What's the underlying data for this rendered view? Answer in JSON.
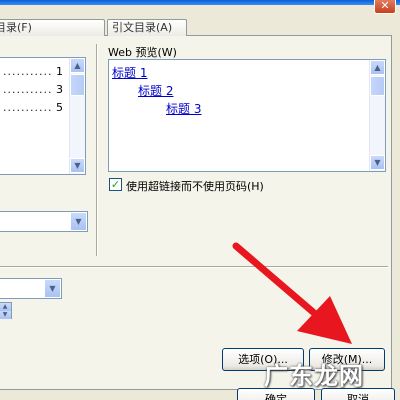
{
  "window": {
    "close_glyph": "✕"
  },
  "tabs": [
    {
      "label": "目录(F)"
    },
    {
      "label": "引文目录(A)"
    }
  ],
  "print_preview": {
    "lines": [
      {
        "dots": "...................",
        "page": "1"
      },
      {
        "dots": "...................",
        "page": "3"
      },
      {
        "dots": "...................",
        "page": "5"
      }
    ]
  },
  "web_preview": {
    "label": "Web 预览(W)",
    "headings": [
      {
        "text": "标题 1"
      },
      {
        "text": "标题 2"
      },
      {
        "text": "标题 3"
      }
    ]
  },
  "options": {
    "use_hyperlinks_label": "使用超链接而不使用页码(H)",
    "use_hyperlinks_checked": true,
    "check_glyph": "✓"
  },
  "icons": {
    "arrow_up": "▲",
    "arrow_down": "▼"
  },
  "buttons": {
    "options": "选项(O)...",
    "modify": "修改(M)...",
    "ok": "确定",
    "cancel": "取消"
  },
  "overlay": {
    "watermark": "广东龙网",
    "arrow_color": "#e8161e"
  }
}
